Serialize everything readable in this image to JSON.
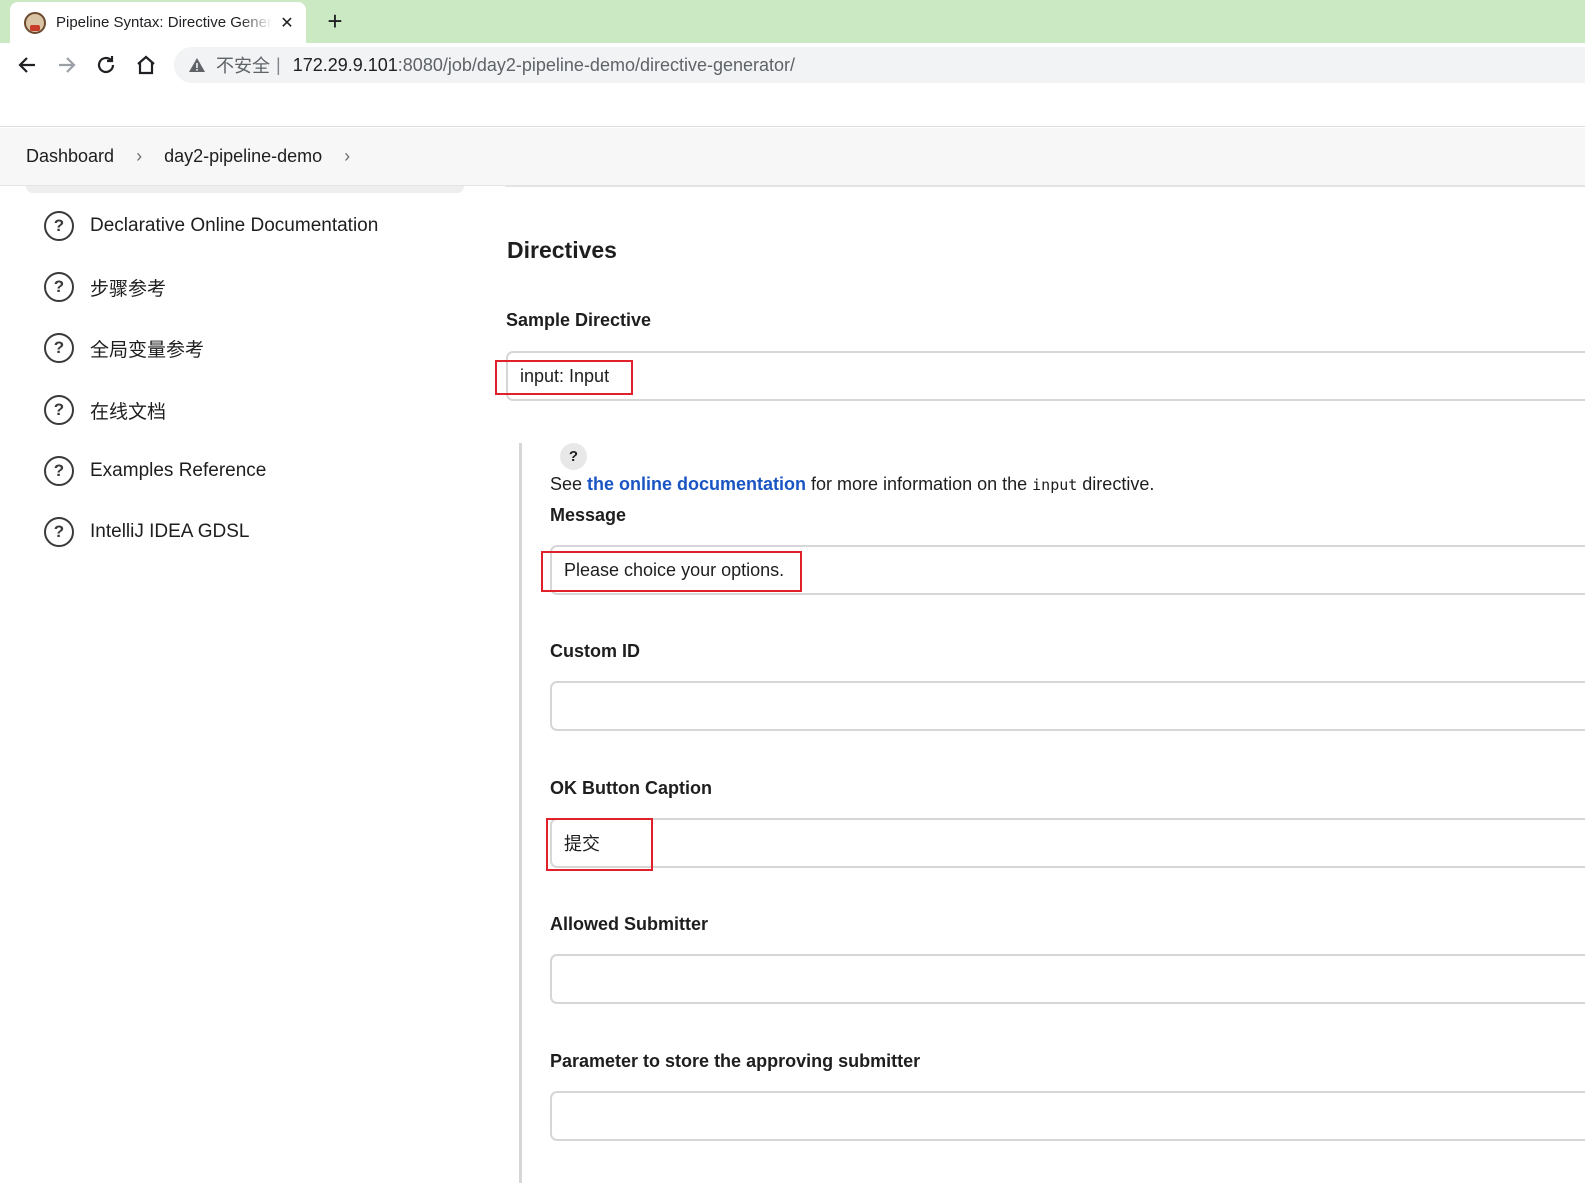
{
  "browser": {
    "tab_title": "Pipeline Syntax: Directive Generator",
    "tab_close": "✕",
    "new_tab": "+",
    "security_label": "不安全",
    "separator": "|",
    "url_host": "172.29.9.101",
    "url_path": ":8080/job/day2-pipeline-demo/directive-generator/"
  },
  "breadcrumb": {
    "items": [
      "Dashboard",
      "day2-pipeline-demo"
    ],
    "separator": "›"
  },
  "sidebar": {
    "items": [
      {
        "label": "Declarative Online Documentation",
        "icon": "help-circle-icon"
      },
      {
        "label": "步骤参考",
        "icon": "help-circle-icon"
      },
      {
        "label": "全局变量参考",
        "icon": "help-circle-icon"
      },
      {
        "label": "在线文档",
        "icon": "help-circle-icon"
      },
      {
        "label": "Examples Reference",
        "icon": "help-circle-icon"
      },
      {
        "label": "IntelliJ IDEA GDSL",
        "icon": "help-circle-icon"
      }
    ]
  },
  "main": {
    "title": "Directives",
    "sample_directive_label": "Sample Directive",
    "sample_directive_value": "input: Input",
    "help": {
      "icon_text": "?",
      "prefix": "See ",
      "link_text": "the online documentation",
      "middle": " for more information on the ",
      "code": "input",
      "suffix": " directive."
    },
    "fields": [
      {
        "label": "Message",
        "value": "Please choice your options."
      },
      {
        "label": "Custom ID",
        "value": ""
      },
      {
        "label": "OK Button Caption",
        "value": "提交"
      },
      {
        "label": "Allowed Submitter",
        "value": ""
      },
      {
        "label": "Parameter to store the approving submitter",
        "value": ""
      }
    ]
  },
  "colors": {
    "tabbar": "#cbe9c2",
    "link": "#1a55c4",
    "highlight": "#e0202a"
  }
}
